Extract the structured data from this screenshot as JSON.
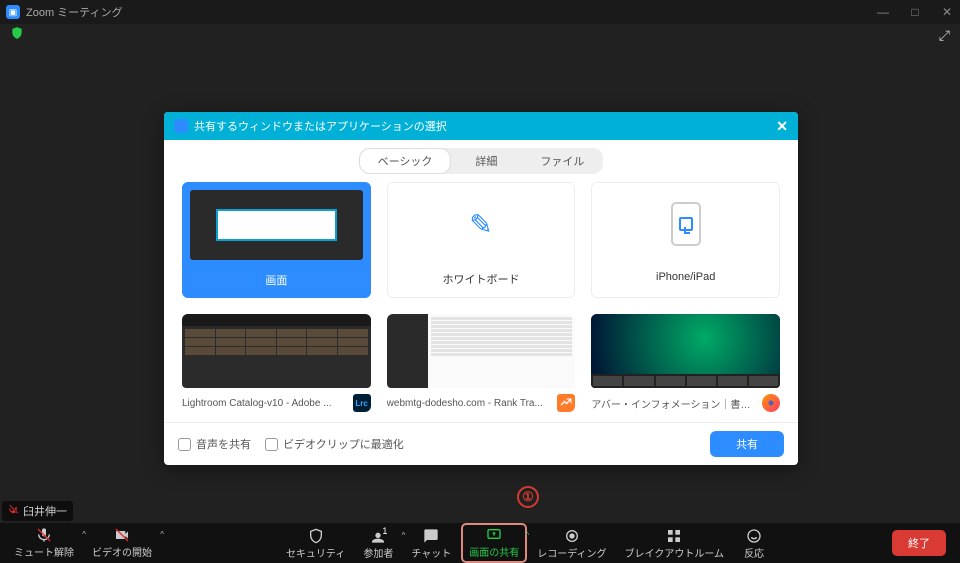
{
  "window": {
    "title": "Zoom ミーティング",
    "minimize": "—",
    "maximize": "□",
    "close": "✕"
  },
  "participant_name": "臼井伸一",
  "annotation": {
    "label_1": "①"
  },
  "dialog": {
    "title": "共有するウィンドウまたはアプリケーションの選択",
    "close": "✕",
    "tabs": {
      "basic": "ベーシック",
      "advanced": "詳細",
      "file": "ファイル"
    },
    "cards": {
      "screen": "画面",
      "whiteboard": "ホワイトボード",
      "iphone_ipad": "iPhone/iPad",
      "lightroom": "Lightroom Catalog-v10 - Adobe ...",
      "lightroom_badge": "Lrc",
      "ranktracker": "webmtg-dodesho.com - Rank Tra...",
      "firefox": "アバー・インフォメーション｜書画カメ..."
    },
    "footer": {
      "share_audio": "音声を共有",
      "optimize_video": "ビデオクリップに最適化",
      "share_button": "共有"
    }
  },
  "toolbar": {
    "mute": "ミュート解除",
    "video": "ビデオの開始",
    "security": "セキュリティ",
    "participants": "参加者",
    "participants_count": "1",
    "chat": "チャット",
    "share_screen": "画面の共有",
    "record": "レコーディング",
    "breakout": "ブレイクアウトルーム",
    "reactions": "反応",
    "end": "終了"
  }
}
